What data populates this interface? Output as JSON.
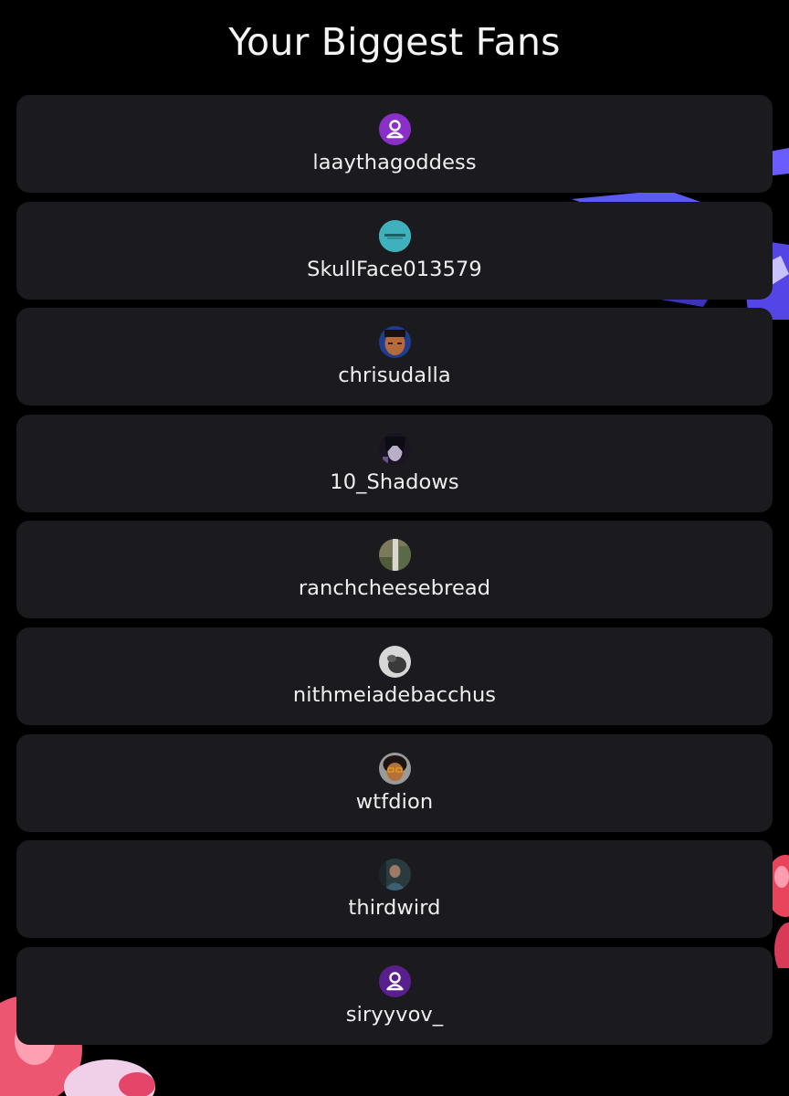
{
  "page": {
    "title": "Your Biggest Fans"
  },
  "colors": {
    "background": "#000000",
    "card": "#1b1b1f",
    "text": "#efeff1",
    "default_avatar": "#8b2fc9"
  },
  "fans": [
    {
      "name": "laaythagoddess",
      "avatar": "default-user-icon"
    },
    {
      "name": "SkullFace013579",
      "avatar": "teal-logo-avatar"
    },
    {
      "name": "chrisudalla",
      "avatar": "photo-avatar"
    },
    {
      "name": "10_Shadows",
      "avatar": "photo-avatar"
    },
    {
      "name": "ranchcheesebread",
      "avatar": "photo-avatar"
    },
    {
      "name": "nithmeiadebacchus",
      "avatar": "photo-avatar"
    },
    {
      "name": "wtfdion",
      "avatar": "cartoon-avatar"
    },
    {
      "name": "thirdwird",
      "avatar": "photo-avatar"
    },
    {
      "name": "siryyvov_",
      "avatar": "default-user-icon"
    }
  ]
}
